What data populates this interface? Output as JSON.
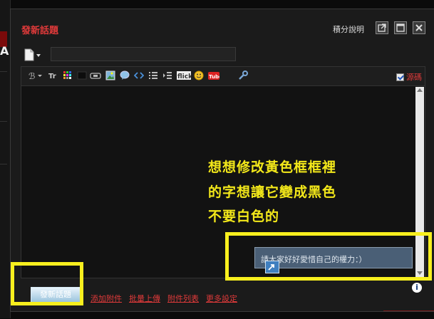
{
  "dialog": {
    "title": "發新話題",
    "help_link": "積分說明"
  },
  "subject": {
    "value": ""
  },
  "editor": {
    "source_label": "源碼",
    "hint_text": "請大家好好愛惜自己的權力：）"
  },
  "annotation": {
    "lines": [
      "想想修改黃色框框裡",
      "的字想讓它變成黑色",
      "不要白色的"
    ],
    "color": "#f3e81a"
  },
  "footer": {
    "submit_label": "發新話題",
    "links": [
      "添加附件",
      "批量上傳",
      "附件列表",
      "更多設定"
    ]
  },
  "colors": {
    "accent_red": "#e03a3a",
    "highlight_yellow": "#f8ef1e",
    "hint_bg": "#4a5f76"
  }
}
